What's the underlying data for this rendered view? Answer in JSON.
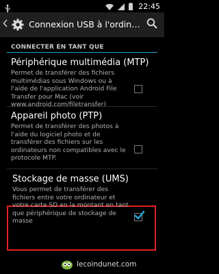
{
  "status_bar": {
    "time": "22:45",
    "icons": [
      "usb-icon",
      "wifi-icon",
      "signal-icon",
      "battery-icon"
    ]
  },
  "action_bar": {
    "title": "Connexion USB à l'ordinateur",
    "back_icon": "chevron-left-icon",
    "app_icon": "gear-icon",
    "search_icon": "search-icon"
  },
  "section": {
    "header": "CONNECTER EN TANT QUE"
  },
  "options": [
    {
      "title": "Périphérique multimédia (MTP)",
      "description": "Permet de transférer des fichiers multimédias sous Windows ou à l'aide de l'application Android File Transfer pour Mac (voir www.android.com/filetransfer)",
      "checked": false
    },
    {
      "title": "Appareil photo (PTP)",
      "description": "Permet de transférer des photos à l'aide du logiciel photo et de transférer des fichiers sur les ordinateurs non compatibles avec le protocole MTP.",
      "checked": false
    },
    {
      "title": "Stockage de masse (UMS)",
      "description": "Vous permet de transférer des fichiers entre votre ordinateur et votre carte SD en la montant en tant que périphérique de stockage de masse",
      "checked": true
    }
  ],
  "watermark": {
    "text": "lecoindunet.com"
  },
  "colors": {
    "accent": "#2aa0d8",
    "highlight": "#e32222",
    "background": "#000000"
  }
}
